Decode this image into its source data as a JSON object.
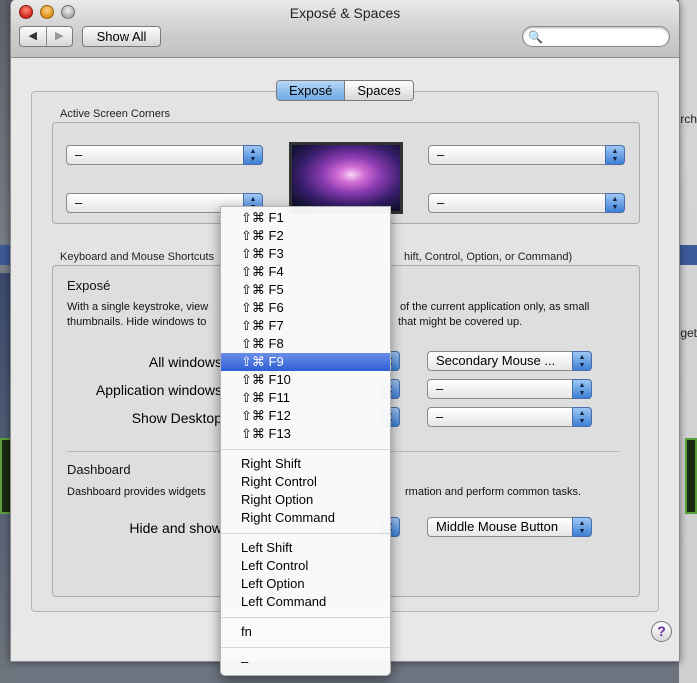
{
  "background": {
    "right_text_top": "earch",
    "right_text_mid": "get"
  },
  "window": {
    "title": "Exposé & Spaces",
    "nav_back": "◀",
    "nav_forward": "▶",
    "show_all": "Show All",
    "search_placeholder": ""
  },
  "tabs": [
    {
      "label": "Exposé",
      "active": true
    },
    {
      "label": "Spaces",
      "active": false
    }
  ],
  "corners": {
    "label": "Active Screen Corners",
    "top_left": "–",
    "bottom_left": "–",
    "top_right": "–",
    "bottom_right": "–"
  },
  "shortcuts": {
    "label": "Keyboard and Mouse Shortcuts",
    "label_tail": "hift, Control, Option, or Command)",
    "expose": {
      "title": "Exposé",
      "desc_line1_a": "With a single keystroke, view",
      "desc_line1_b": "of the current application only, as small",
      "desc_line2_a": "thumbnails. Hide windows to",
      "desc_line2_b": "that might be covered up.",
      "rows": [
        {
          "label": "All windows",
          "mouse": "Secondary Mouse ..."
        },
        {
          "label": "Application windows",
          "mouse": "–"
        },
        {
          "label": "Show Desktop",
          "mouse": "–"
        }
      ]
    },
    "dashboard": {
      "title": "Dashboard",
      "desc_a": "Dashboard provides widgets",
      "desc_b": "rmation and perform common tasks.",
      "row_label": "Hide and show",
      "mouse": "Middle Mouse Button"
    }
  },
  "menu": {
    "groups": [
      [
        "⇧⌘ F1",
        "⇧⌘ F2",
        "⇧⌘ F3",
        "⇧⌘ F4",
        "⇧⌘ F5",
        "⇧⌘ F6",
        "⇧⌘ F7",
        "⇧⌘ F8",
        "⇧⌘ F9",
        "⇧⌘ F10",
        "⇧⌘ F11",
        "⇧⌘ F12",
        "⇧⌘ F13"
      ],
      [
        "Right Shift",
        "Right Control",
        "Right Option",
        "Right Command"
      ],
      [
        "Left Shift",
        "Left Control",
        "Left Option",
        "Left Command"
      ],
      [
        "fn"
      ],
      [
        "–"
      ]
    ],
    "selected": "⇧⌘ F9"
  },
  "help": "?"
}
